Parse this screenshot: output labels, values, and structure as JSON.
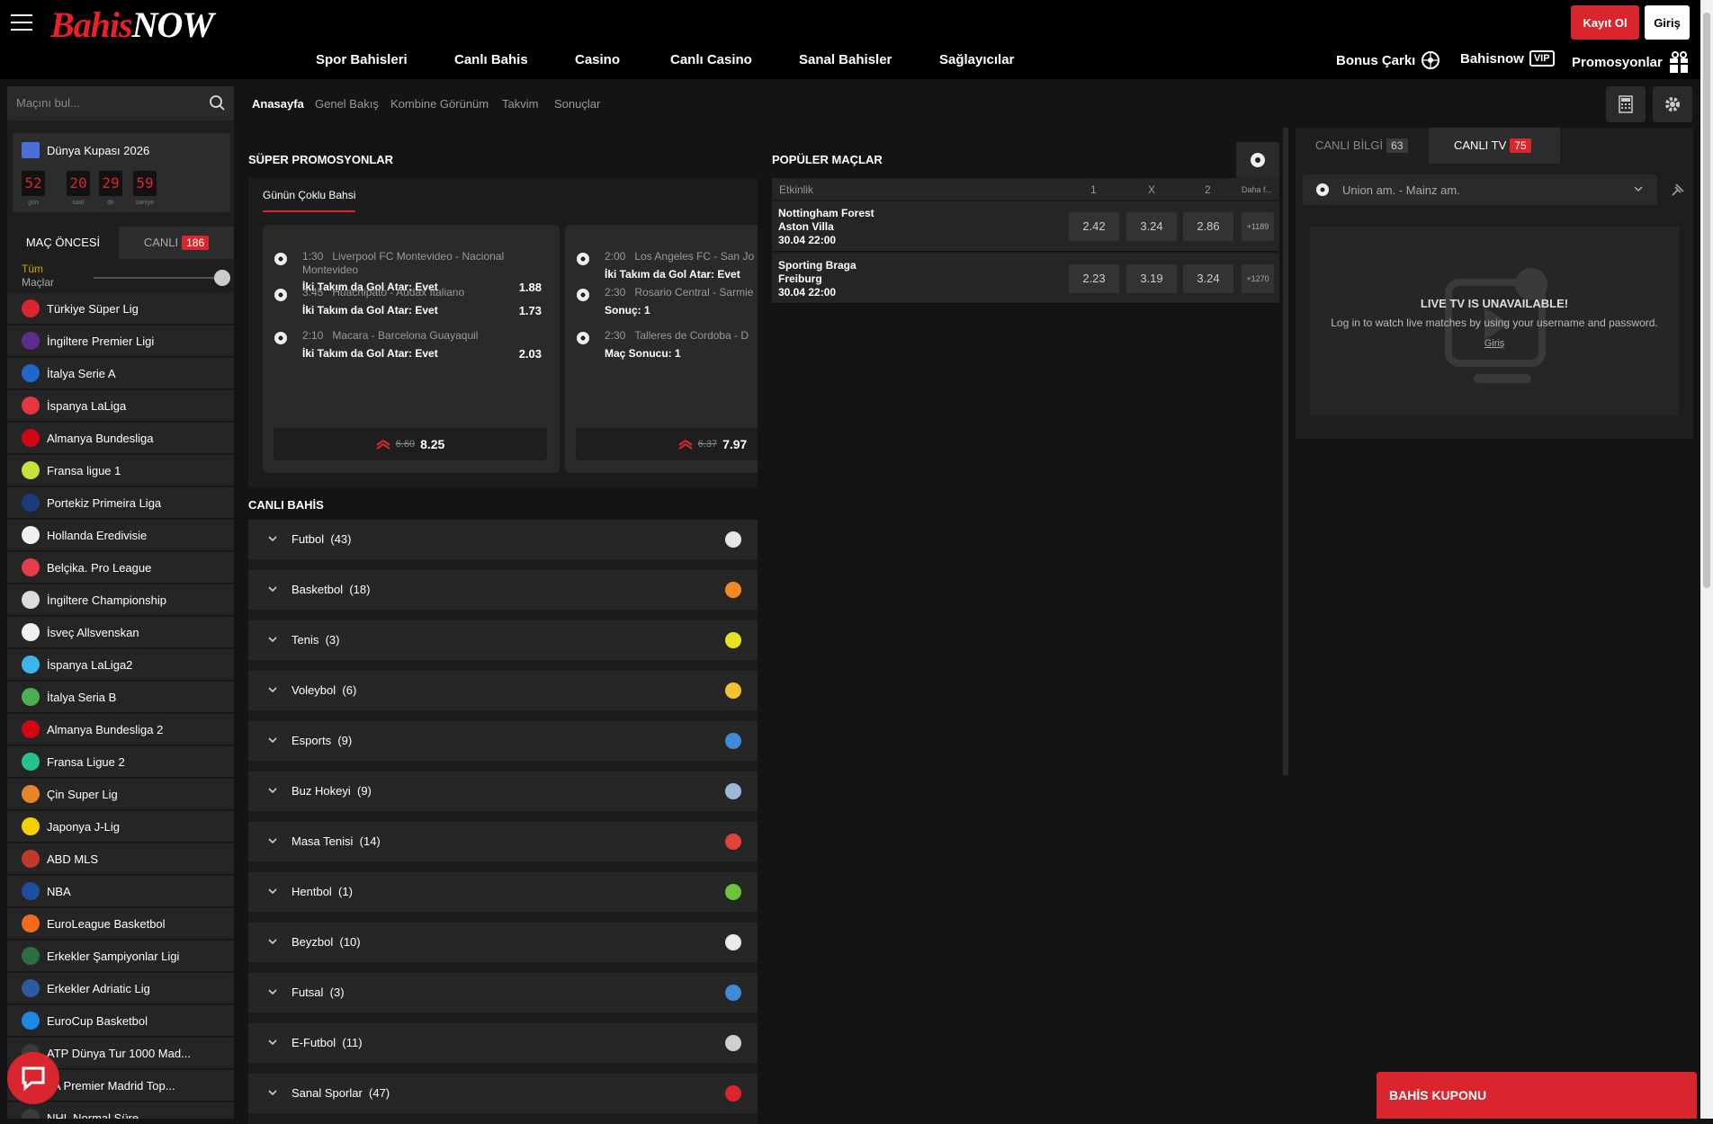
{
  "header": {
    "logo_main": "Bahis",
    "logo_accent": "NOW",
    "nav": [
      "Spor Bahisleri",
      "Canlı Bahis",
      "Casino",
      "Canlı Casino",
      "Sanal Bahisler",
      "Sağlayıcılar"
    ],
    "register": "Kayıt Ol",
    "login": "Giriş",
    "bonus": "Bonus Çarkı",
    "vip_prefix": "Bahisnow",
    "vip": "VIP",
    "promos": "Promosyonlar"
  },
  "sidebar": {
    "search_placeholder": "Maçını bul...",
    "worldcup": {
      "title": "Dünya Kupası 2026",
      "digits": [
        "52",
        "20",
        "29",
        "59"
      ],
      "labels": [
        "gün",
        "saat",
        "dk",
        "saniye"
      ]
    },
    "tab_pre": "MAÇ ÖNCESİ",
    "tab_live": "CANLI",
    "live_count": "186",
    "all_label_1": "Tüm",
    "all_label_2": "Maçlar",
    "leagues": [
      {
        "name": "Türkiye Süper Lig",
        "color": "#d9252d"
      },
      {
        "name": "İngiltere Premier Ligi",
        "color": "#5b2e8c"
      },
      {
        "name": "İtalya Serie A",
        "color": "#1f66c9"
      },
      {
        "name": "İspanya LaLiga",
        "color": "#e2383f"
      },
      {
        "name": "Almanya Bundesliga",
        "color": "#d20515"
      },
      {
        "name": "Fransa ligue 1",
        "color": "#c8e03a"
      },
      {
        "name": "Portekiz Primeira Liga",
        "color": "#1b3a7a"
      },
      {
        "name": "Hollanda Eredivisie",
        "color": "#f0f0f0"
      },
      {
        "name": "Belçika. Pro League",
        "color": "#e63c4b"
      },
      {
        "name": "İngiltere Championship",
        "color": "#dcdcdc"
      },
      {
        "name": "İsveç Allsvenskan",
        "color": "#f0f0f0"
      },
      {
        "name": "İspanya LaLiga2",
        "color": "#3bb6e8"
      },
      {
        "name": "İtalya Seria B",
        "color": "#4caf50"
      },
      {
        "name": "Almanya Bundesliga 2",
        "color": "#d20515"
      },
      {
        "name": "Fransa Ligue 2",
        "color": "#27c08f"
      },
      {
        "name": "Çin Super Lig",
        "color": "#e8852b"
      },
      {
        "name": "Japonya J-Lig",
        "color": "#f4d000"
      },
      {
        "name": "ABD MLS",
        "color": "#c0392b"
      },
      {
        "name": "NBA",
        "color": "#1d4f9e"
      },
      {
        "name": "EuroLeague Basketbol",
        "color": "#f26b1d"
      },
      {
        "name": "Erkekler Şampiyonlar Ligi",
        "color": "#2a6f3e"
      },
      {
        "name": "Erkekler Adriatic Lig",
        "color": "#2c5aa0"
      },
      {
        "name": "EuroCup Basketbol",
        "color": "#1e88e5"
      },
      {
        "name": "ATP Dünya Tur 1000 Mad...",
        "color": "#3a3a3a"
      },
      {
        "name": "TA Premier Madrid Top...",
        "color": "#3a3a3a"
      },
      {
        "name": "NHL Normal Süre",
        "color": "#3a3a3a"
      }
    ]
  },
  "subnav": [
    "Anasayfa",
    "Genel Bakış",
    "Kombine Görünüm",
    "Takvim",
    "Sonuçlar"
  ],
  "super_promos": {
    "title": "SÜPER PROMOSYONLAR",
    "tab": "Günün Çoklu Bahsi",
    "cards": [
      {
        "rows": [
          {
            "time": "1:30",
            "match": "Liverpool FC Montevideo - Nacional Montevideo",
            "sel": "İki Takım da Gol Atar: Evet",
            "odd": "1.88"
          },
          {
            "time": "3:45",
            "match": "Huachipato - Audax Italiano",
            "sel": "İki Takım da Gol Atar: Evet",
            "odd": "1.73"
          },
          {
            "time": "2:10",
            "match": "Macara - Barcelona Guayaquil",
            "sel": "İki Takım da Gol Atar: Evet",
            "odd": "2.03"
          }
        ],
        "old": "6.60",
        "new": "8.25"
      },
      {
        "rows": [
          {
            "time": "2:00",
            "match": "Los Angeles FC - San Jo",
            "sel": "İki Takım da Gol Atar: Evet",
            "odd": ""
          },
          {
            "time": "2:30",
            "match": "Rosario Central - Sarmie",
            "sel": "Sonuç: 1",
            "odd": ""
          },
          {
            "time": "2:30",
            "match": "Talleres de Cordoba - D",
            "sel": "Maç Sonucu: 1",
            "odd": ""
          }
        ],
        "old": "6.37",
        "new": "7.97"
      }
    ]
  },
  "popular": {
    "title": "POPÜLER MAÇLAR",
    "headers": [
      "Etkinlik",
      "1",
      "X",
      "2",
      "Daha f..."
    ],
    "rows": [
      {
        "home": "Nottingham Forest",
        "away": "Aston Villa",
        "date": "30.04 22:00",
        "o1": "2.42",
        "ox": "3.24",
        "o2": "2.86",
        "more": "+1189"
      },
      {
        "home": "Sporting Braga",
        "away": "Freiburg",
        "date": "30.04 22:00",
        "o1": "2.23",
        "ox": "3.19",
        "o2": "3.24",
        "more": "+1270"
      }
    ]
  },
  "live": {
    "title": "CANLI BAHİS",
    "sports": [
      {
        "name": "Futbol",
        "count": "(43)",
        "color": "#e6e6e6"
      },
      {
        "name": "Basketbol",
        "count": "(18)",
        "color": "#f08a24"
      },
      {
        "name": "Tenis",
        "count": "(3)",
        "color": "#e8e020"
      },
      {
        "name": "Voleybol",
        "count": "(6)",
        "color": "#f2c12e"
      },
      {
        "name": "Esports",
        "count": "(9)",
        "color": "#3d8bd9"
      },
      {
        "name": "Buz Hokeyi",
        "count": "(9)",
        "color": "#9bb8d8"
      },
      {
        "name": "Masa Tenisi",
        "count": "(14)",
        "color": "#e0433a"
      },
      {
        "name": "Hentbol",
        "count": "(1)",
        "color": "#6fc23b"
      },
      {
        "name": "Beyzbol",
        "count": "(10)",
        "color": "#eaeaea"
      },
      {
        "name": "Futsal",
        "count": "(3)",
        "color": "#3d8bd9"
      },
      {
        "name": "E-Futbol",
        "count": "(11)",
        "color": "#cfcfcf"
      },
      {
        "name": "Sanal Sporlar",
        "count": "(47)",
        "color": "#d9252d"
      }
    ]
  },
  "right": {
    "tab_info": "CANLI BİLGİ",
    "info_count": "63",
    "tab_tv": "CANLI TV",
    "tv_count": "75",
    "select": "Union am. - Mainz am.",
    "tv_title": "LIVE TV IS UNAVAILABLE!",
    "tv_msg": "Log in to watch live matches by using your username and password.",
    "tv_link": "Giriş"
  },
  "coupon": "BAHİS KUPONU",
  "colors": {
    "accent": "#d9252d",
    "bg": "#141414"
  }
}
